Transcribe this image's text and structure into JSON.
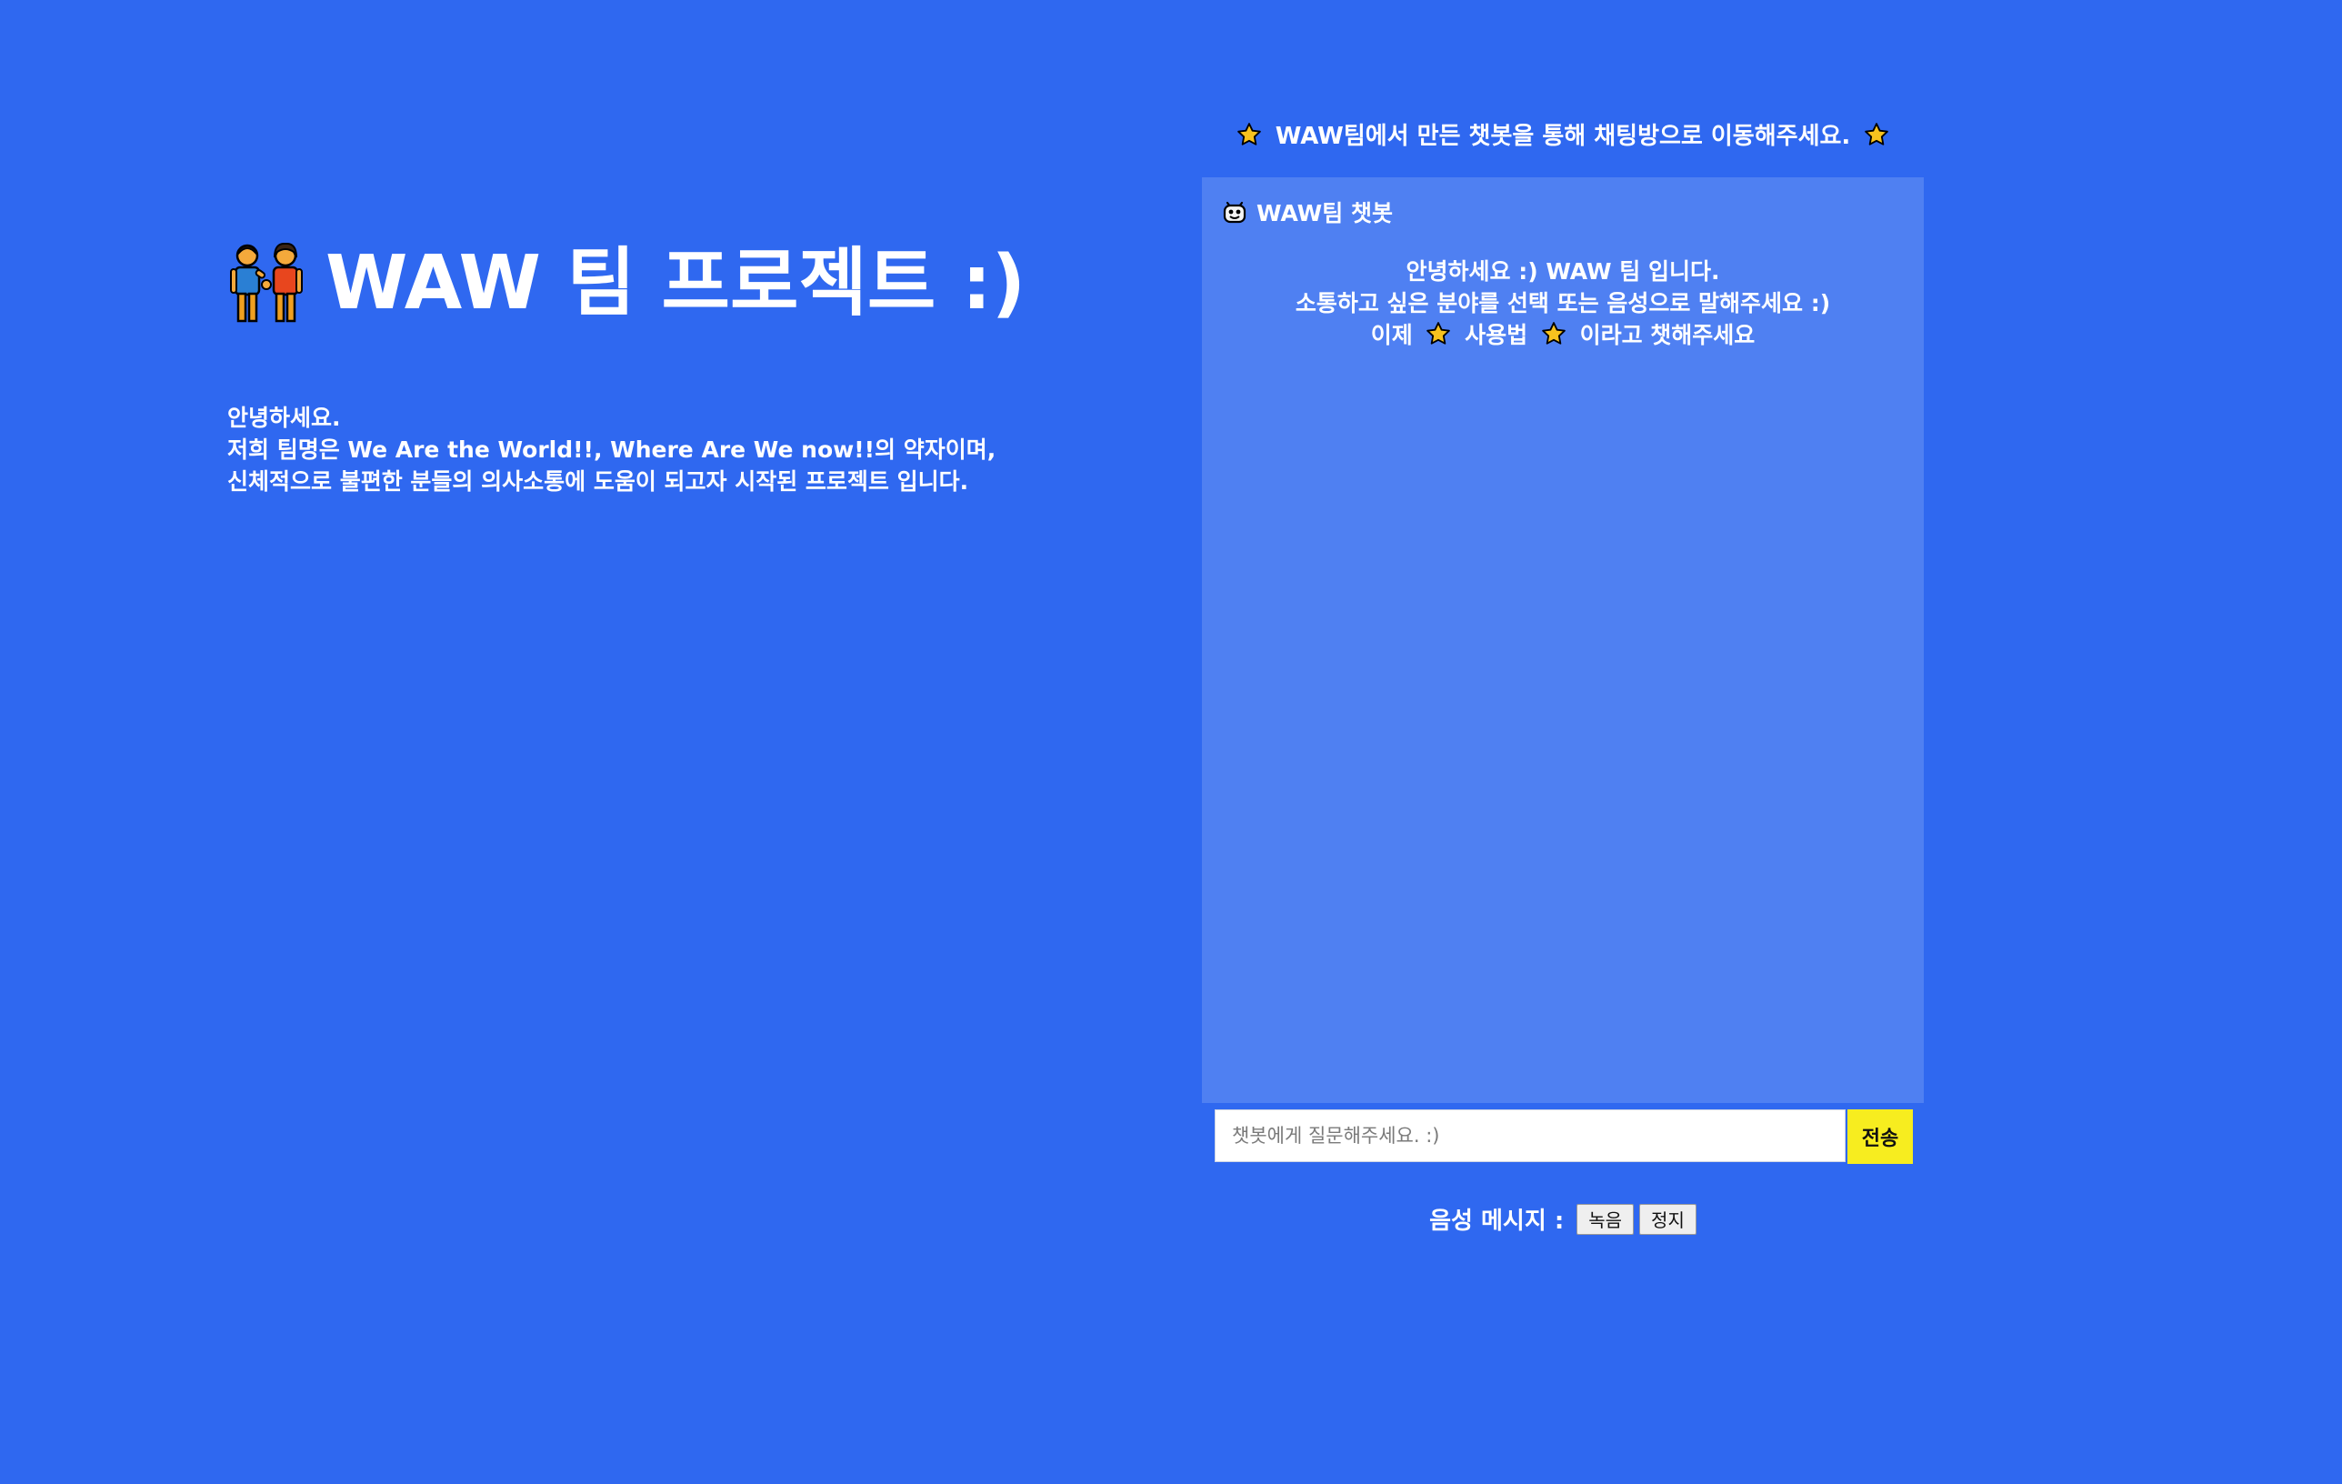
{
  "colors": {
    "background": "#2f68f0",
    "chat_panel": "#4f80f2",
    "send_button": "#f7ed1f",
    "text": "#ffffff"
  },
  "header": {
    "icon": "people-holding-hands-icon",
    "title": "WAW 팀 프로젝트 :)"
  },
  "intro": {
    "lines": [
      "안녕하세요.",
      "저희 팀명은 We Are the World!!, Where Are We now!!의 약자이며,",
      "신체적으로 불편한 분들의 의사소통에 도움이 되고자 시작된 프로젝트 입니다."
    ]
  },
  "notice": {
    "icon": "star-icon",
    "text": "WAW팀에서 만든 챗봇을 통해 채팅방으로 이동해주세요."
  },
  "chat": {
    "bot_icon": "robot-face-icon",
    "title": "WAW팀 챗봇",
    "greeting": {
      "line1": "안녕하세요 :) WAW 팀 입니다.",
      "line2": "소통하고 싶은 분야를 선택 또는 음성으로 말해주세요 :)",
      "line3_prefix": "이제",
      "line3_keyword": "사용법",
      "line3_suffix": "이라고 챗해주세요"
    },
    "input_placeholder": "챗봇에게 질문해주세요. :)",
    "input_value": "",
    "send_label": "전송"
  },
  "voice": {
    "label": "음성 메시지 :",
    "record_label": "녹음",
    "stop_label": "정지"
  }
}
